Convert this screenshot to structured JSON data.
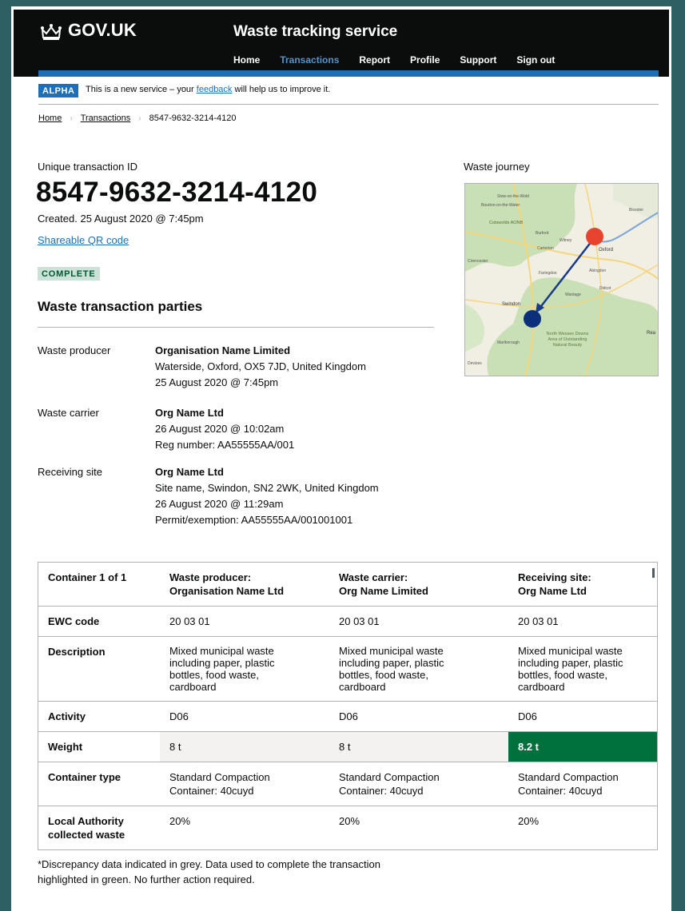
{
  "header": {
    "logo": "GOV.UK",
    "service_name": "Waste tracking service",
    "nav": [
      "Home",
      "Transactions",
      "Report",
      "Profile",
      "Support",
      "Sign out"
    ],
    "active_nav": "Transactions"
  },
  "phase_banner": {
    "tag": "ALPHA",
    "text_before": "This is a new service – your ",
    "link": "feedback",
    "text_after": " will help us to improve it."
  },
  "breadcrumbs": [
    "Home",
    "Transactions",
    "8547-9632-3214-4120"
  ],
  "transaction": {
    "id_label": "Unique transaction ID",
    "id": "8547-9632-3214-4120",
    "created": "Created. 25 August 2020 @ 7:45pm",
    "qr_link": "Shareable QR code",
    "status": "COMPLETE"
  },
  "parties": {
    "heading": "Waste transaction parties",
    "items": [
      {
        "label": "Waste producer",
        "name": "Organisation Name Limited",
        "lines": [
          "Waterside, Oxford, OX5 7JD, United Kingdom",
          "25 August 2020 @ 7:45pm"
        ]
      },
      {
        "label": "Waste carrier",
        "name": "Org Name Ltd",
        "lines": [
          "26 August 2020 @ 10:02am",
          "Reg number: AA55555AA/001"
        ]
      },
      {
        "label": "Receiving site",
        "name": "Org Name Ltd",
        "lines": [
          "Site name, Swindon, SN2 2WK, United Kingdom",
          "26 August 2020 @ 11:29am",
          "Permit/exemption: AA55555AA/001001001"
        ]
      }
    ]
  },
  "map": {
    "label": "Waste journey",
    "places": [
      "Stow-on-the-Wold",
      "Bourton-on-the-Water",
      "Cotswolds AONB",
      "Burford",
      "Witney",
      "Bicester",
      "Carterton",
      "Oxford",
      "Cirencester",
      "Abingdon",
      "Faringdon",
      "Didcot",
      "Wantage",
      "Swindon",
      "North Wessex Downs Area of Outstanding Natural Beauty",
      "Marlborough",
      "Devizes",
      "Rea"
    ],
    "origin_color": "#e8432e",
    "destination_color": "#0b2f7a"
  },
  "table": {
    "header": [
      "Container 1 of 1",
      "Waste producer:",
      "Waste carrier:",
      "Receiving site:"
    ],
    "header_sub": [
      "",
      "Organisation Name Ltd",
      "Org Name Limited",
      "Org Name Ltd"
    ],
    "rows": {
      "ewc": [
        "EWC code",
        "20 03 01",
        "20 03 01",
        "20 03 01"
      ],
      "description": [
        "Description",
        "Mixed municipal waste including paper, plastic bottles, food waste, cardboard",
        "Mixed municipal waste including paper, plastic bottles, food waste, cardboard",
        "Mixed municipal waste including paper, plastic bottles, food waste, cardboard"
      ],
      "activity": [
        "Activity",
        "D06",
        "D06",
        "D06"
      ],
      "weight": [
        "Weight",
        "8 t",
        "8 t",
        "8.2 t"
      ],
      "container_type": [
        "Container type",
        "Standard Compaction Container: 40cuyd",
        "Standard Compaction Container: 40cuyd",
        "Standard Compaction Container: 40cuyd"
      ],
      "local_authority": [
        "Local Authority collected waste",
        "20%",
        "20%",
        "20%"
      ]
    },
    "highlight_colors": {
      "discrepancy": "#f3f2f1",
      "used": "#00703c"
    }
  },
  "footnote": "*Discrepancy data indicated in grey. Data used to complete the transaction highlighted in green. No further action required."
}
